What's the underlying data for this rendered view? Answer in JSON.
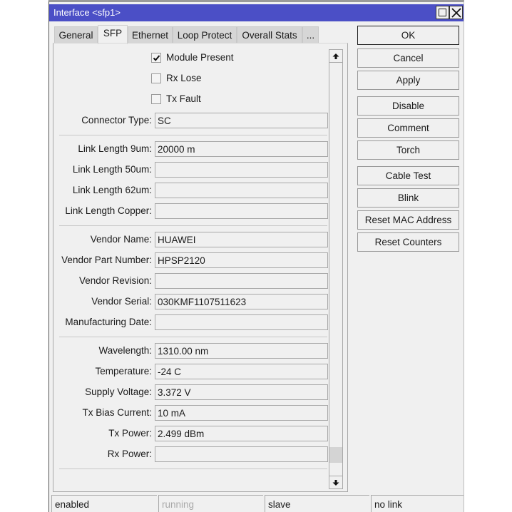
{
  "window": {
    "title": "Interface <sfp1>",
    "maximize_icon": "maximize-icon",
    "close_icon": "close-icon"
  },
  "tabs": [
    {
      "label": "General",
      "active": false
    },
    {
      "label": "SFP",
      "active": true
    },
    {
      "label": "Ethernet",
      "active": false
    },
    {
      "label": "Loop Protect",
      "active": false
    },
    {
      "label": "Overall Stats",
      "active": false
    },
    {
      "label": "...",
      "active": false
    }
  ],
  "checkboxes": [
    {
      "label": "Module Present",
      "checked": true
    },
    {
      "label": "Rx Lose",
      "checked": false
    },
    {
      "label": "Tx Fault",
      "checked": false
    }
  ],
  "fields": {
    "connector_type": {
      "label": "Connector Type:",
      "value": "SC"
    },
    "link_length_9um": {
      "label": "Link Length 9um:",
      "value": "20000 m"
    },
    "link_length_50um": {
      "label": "Link Length 50um:",
      "value": ""
    },
    "link_length_62um": {
      "label": "Link Length 62um:",
      "value": ""
    },
    "link_length_copper": {
      "label": "Link Length Copper:",
      "value": ""
    },
    "vendor_name": {
      "label": "Vendor Name:",
      "value": "HUAWEI"
    },
    "vendor_part_number": {
      "label": "Vendor Part Number:",
      "value": "HPSP2120"
    },
    "vendor_revision": {
      "label": "Vendor Revision:",
      "value": ""
    },
    "vendor_serial": {
      "label": "Vendor Serial:",
      "value": "030KMF1107511623"
    },
    "manufacturing_date": {
      "label": "Manufacturing Date:",
      "value": ""
    },
    "wavelength": {
      "label": "Wavelength:",
      "value": "1310.00 nm"
    },
    "temperature": {
      "label": "Temperature:",
      "value": "-24 C"
    },
    "supply_voltage": {
      "label": "Supply Voltage:",
      "value": "3.372 V"
    },
    "tx_bias_current": {
      "label": "Tx Bias Current:",
      "value": "10 mA"
    },
    "tx_power": {
      "label": "Tx Power:",
      "value": "2.499 dBm"
    },
    "rx_power": {
      "label": "Rx Power:",
      "value": ""
    }
  },
  "scrollbar": {
    "up_icon": "arrow-up-icon",
    "down_icon": "arrow-down-icon",
    "position_fraction": 0.97
  },
  "buttons": {
    "ok": "OK",
    "cancel": "Cancel",
    "apply": "Apply",
    "disable": "Disable",
    "comment": "Comment",
    "torch": "Torch",
    "cable_test": "Cable Test",
    "blink": "Blink",
    "reset_mac": "Reset MAC Address",
    "reset_counters": "Reset Counters"
  },
  "status_bar": {
    "enabled": "enabled",
    "running": "running",
    "role": "slave",
    "link": "no link"
  },
  "colors": {
    "titlebar": "#4b4fc6",
    "dim_text": "#a9a9a9"
  }
}
